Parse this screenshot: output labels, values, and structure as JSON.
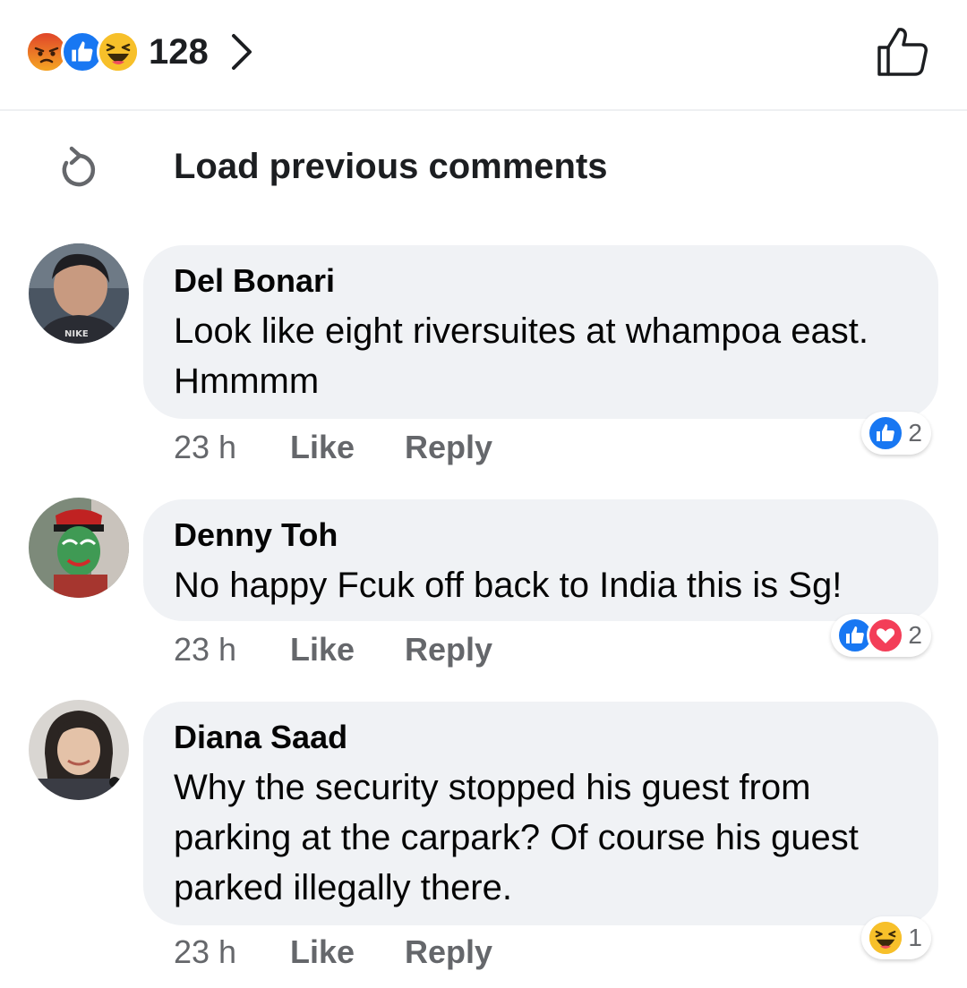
{
  "reaction_summary": {
    "icons": [
      "angry-reaction",
      "like-reaction",
      "haha-reaction"
    ],
    "count": "128"
  },
  "load_previous": {
    "label": "Load previous comments"
  },
  "colors": {
    "like_blue": "#1877f2",
    "love_red": "#f33e58",
    "angry_orange": "#e9710f",
    "haha_yellow": "#f7b928",
    "bubble_bg": "#f0f2f5",
    "meta_gray": "#65676b"
  },
  "comments": [
    {
      "author": "Del Bonari",
      "text": "Look like eight riversuites at whampoa east. Hmmmm",
      "time": "23 h",
      "like_label": "Like",
      "reply_label": "Reply",
      "reactions": [
        "like-reaction"
      ],
      "reaction_count": "2"
    },
    {
      "author": "Denny Toh",
      "text": "No happy Fcuk off back to India this is Sg!",
      "time": "23 h",
      "like_label": "Like",
      "reply_label": "Reply",
      "reactions": [
        "like-reaction",
        "love-reaction"
      ],
      "reaction_count": "2"
    },
    {
      "author": "Diana Saad",
      "text": "Why the security stopped his guest from parking at the carpark? Of course his guest parked illegally there.",
      "time": "23 h",
      "like_label": "Like",
      "reply_label": "Reply",
      "reactions": [
        "haha-reaction"
      ],
      "reaction_count": "1"
    }
  ]
}
